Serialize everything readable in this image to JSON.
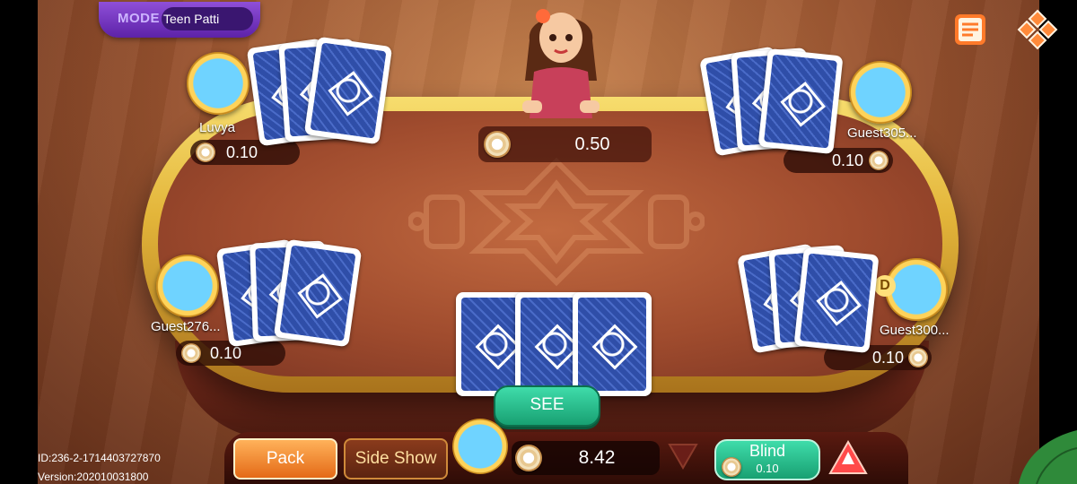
{
  "header": {
    "mode_label": "MODE",
    "mode_value": "Teen Patti"
  },
  "top_icons": {
    "rules": "scroll-icon",
    "menu": "diamond-menu-icon"
  },
  "pot": {
    "value": "0.50"
  },
  "players": [
    {
      "name": "Luvya",
      "bet": "0.10"
    },
    {
      "name": "Guest305...",
      "bet": "0.10"
    },
    {
      "name": "Guest276...",
      "bet": "0.10"
    },
    {
      "name": "Guest300...",
      "bet": "0.10"
    }
  ],
  "dealer_marker": "D",
  "actions": {
    "see": "SEE",
    "pack": "Pack",
    "side_show": "Side Show",
    "blind": "Blind",
    "blind_amount": "0.10"
  },
  "me": {
    "balance": "8.42"
  },
  "info": {
    "id": "ID:236-2-1714403727870",
    "version": "Version:202010031800"
  },
  "colors": {
    "accent_green": "#18a072",
    "accent_orange": "#e46a17",
    "mode_purple": "#5d22a8",
    "table_gold": "#e3b53a"
  }
}
